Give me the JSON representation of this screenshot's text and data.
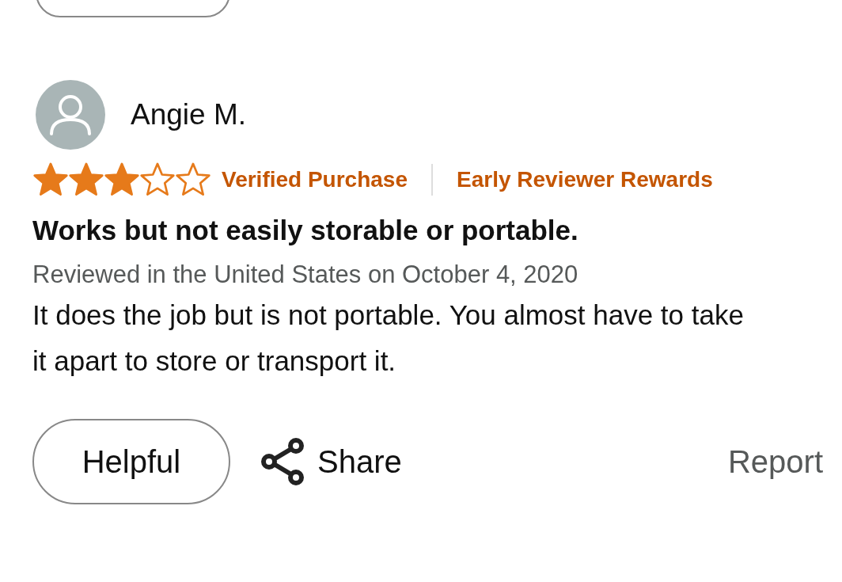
{
  "review": {
    "reviewer": "Angie M.",
    "stars": 3,
    "badges": [
      "Verified Purchase",
      "Early Reviewer Rewards"
    ],
    "title": "Works but not easily storable or portable.",
    "date": "Reviewed in the United States on October 4, 2020",
    "body": "It does the job but is not portable. You almost have to take it apart to store or transport it."
  },
  "actions": {
    "helpful": "Helpful",
    "share": "Share",
    "report": "Report"
  }
}
